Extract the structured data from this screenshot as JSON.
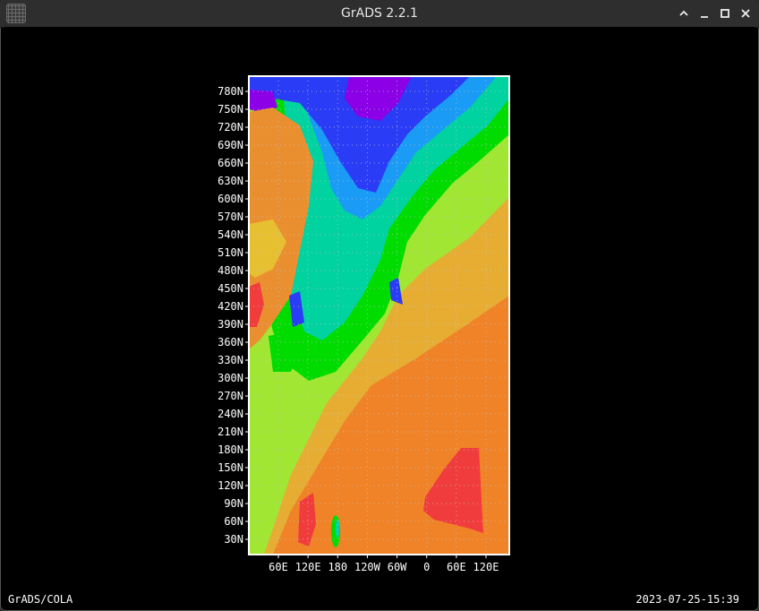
{
  "window": {
    "title": "GrADS 2.2.1",
    "controls": [
      "minimize-chevron",
      "minimize",
      "maximize",
      "close"
    ]
  },
  "footer": {
    "left": "GrADS/COLA",
    "right": "2023-07-25-15:39"
  },
  "chart_data": {
    "type": "heatmap",
    "title": "",
    "xlabel": "",
    "ylabel": "",
    "x_ticks": [
      "60E",
      "120E",
      "180",
      "120W",
      "60W",
      "0",
      "60E",
      "120E"
    ],
    "y_ticks": [
      "780N",
      "750N",
      "720N",
      "690N",
      "660N",
      "630N",
      "600N",
      "570N",
      "540N",
      "510N",
      "480N",
      "450N",
      "420N",
      "390N",
      "360N",
      "330N",
      "300N",
      "270N",
      "240N",
      "210N",
      "180N",
      "150N",
      "120N",
      "90N",
      "60N",
      "30N"
    ],
    "grid": true,
    "grid_style": "dotted",
    "colors": {
      "violet": "#8b00e6",
      "blue": "#2a3cf5",
      "azure": "#1a9bf5",
      "teal": "#00d2a0",
      "green": "#00dc00",
      "lime": "#a0e632",
      "yellow": "#e6dc32",
      "orange": "#f08228",
      "red": "#f03c3c",
      "frame": "#ffffff",
      "background": "#000000"
    }
  }
}
